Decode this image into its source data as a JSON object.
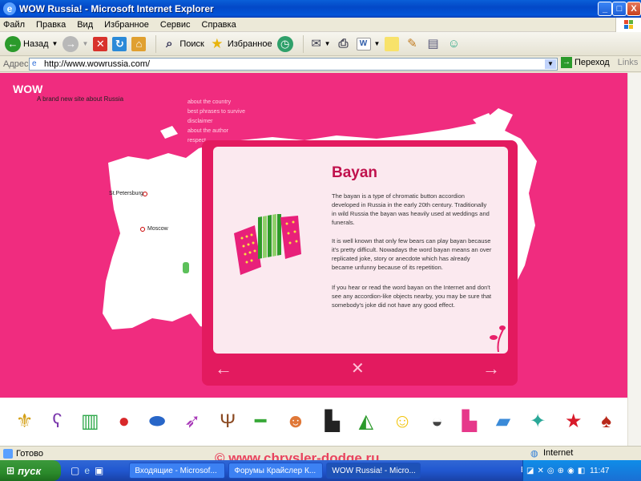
{
  "window": {
    "title": "WOW Russia! - Microsoft Internet Explorer",
    "min_label": "_",
    "max_label": "□",
    "close_label": "X"
  },
  "menu": [
    "Файл",
    "Правка",
    "Вид",
    "Избранное",
    "Сервис",
    "Справка"
  ],
  "toolbar": {
    "back_label": "Назад",
    "search_label": "Поиск",
    "favorites_label": "Избранное"
  },
  "address": {
    "label": "Адрес:",
    "url": "http://www.wowrussia.com/",
    "go_label": "Переход",
    "links_label": "Links"
  },
  "site": {
    "logo": "WOW",
    "tagline": "A brand new site about Russia",
    "nav": [
      "about the country",
      "best phrases to survive",
      "disclaimer",
      "about the author",
      "respect"
    ],
    "map_labels": {
      "spb": "St.Petersburg",
      "moscow": "Moscow"
    }
  },
  "article": {
    "title": "Bayan",
    "paragraphs": [
      "The bayan is a type of chromatic button accordion developed in Russia in the early 20th century. Traditionally in wild Russia the bayan was heavily used at weddings and funerals.",
      "It is well known that only few bears can play bayan because it's pretty difficult. Nowadays the word bayan means an over replicated joke, story or anecdote which has already became unfunny because of its repetition.",
      "If you hear or read the word bayan on the Internet and don't see any accordion-like objects nearby, you may be sure that somebody's joke did not have any good effect."
    ],
    "nav": {
      "prev": "←",
      "close": "✕",
      "next": "→"
    }
  },
  "icon_strip": [
    "coat-of-arms-icon",
    "misha-bear-icon",
    "trash-bin-icon",
    "matryoshka-icon",
    "valenki-boot-icon",
    "rocket-icon",
    "tree-icon",
    "kalashnikov-icon",
    "cheburashka-icon",
    "boots-icon",
    "balalaika-icon",
    "smiley-icon",
    "ushanka-hat-icon",
    "pink-boot-icon",
    "polar-bear-icon",
    "firebird-icon",
    "red-star-icon",
    "spoon-icon"
  ],
  "status": {
    "text": "Готово",
    "zone": "Internet"
  },
  "taskbar": {
    "start_label": "пуск",
    "tasks": [
      "Входящие - Microsof...",
      "Форумы Крайслер К...",
      "WOW Russia! - Micro..."
    ],
    "lang": "EN",
    "time": "11:47"
  },
  "watermark": "© www.chrysler-dodge.ru",
  "colors": {
    "accent": "#f02c7f",
    "modal": "#e31a5f",
    "title_text": "#c0124d"
  }
}
